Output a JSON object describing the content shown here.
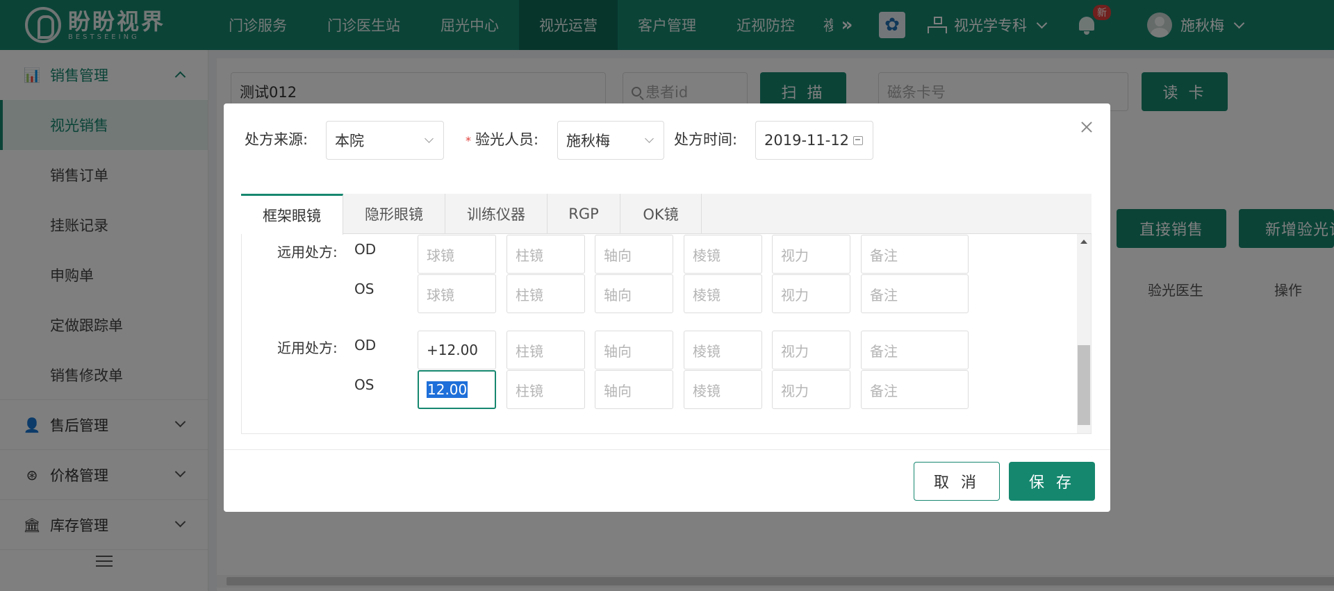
{
  "app": {
    "logo_cn": "盼盼视界",
    "logo_en": "BESTSEEING"
  },
  "topnav": {
    "items": [
      "门诊服务",
      "门诊医生站",
      "屈光中心",
      "视光运营",
      "客户管理",
      "近视防控",
      "複"
    ],
    "active_index": 3,
    "more_icon": "double-chevron-right-icon",
    "department": "视光学专科",
    "notification_badge": "新",
    "user_name": "施秋梅"
  },
  "sidebar": {
    "groups": [
      {
        "label": "销售管理",
        "icon": "chart-icon",
        "open": true,
        "items": [
          "视光销售",
          "销售订单",
          "挂账记录",
          "申购单",
          "定做跟踪单",
          "销售修改单"
        ],
        "active_index": 0
      },
      {
        "label": "售后管理",
        "icon": "user-service-icon",
        "open": false
      },
      {
        "label": "价格管理",
        "icon": "price-icon",
        "open": false
      },
      {
        "label": "库存管理",
        "icon": "warehouse-icon",
        "open": false
      }
    ]
  },
  "main": {
    "patient_name_value": "测试012",
    "patient_id_placeholder": "患者id",
    "scan_button": "扫 描",
    "card_placeholder": "磁条卡号",
    "read_card_button": "读 卡",
    "direct_sale_button": "直接销售",
    "add_optometry_button": "新增验光记",
    "table_headers": [
      "验光医生",
      "操作"
    ]
  },
  "modal": {
    "source_label": "处方来源:",
    "source_value": "本院",
    "optometrist_label": "验光人员:",
    "optometrist_value": "施秋梅",
    "time_label": "处方时间:",
    "time_value": "2019-11-12",
    "tabs": [
      "框架眼镜",
      "隐形眼镜",
      "训练仪器",
      "RGP",
      "OK镜"
    ],
    "active_tab": 0,
    "far_label": "远用处方:",
    "near_label": "近用处方:",
    "eyes": [
      "OD",
      "OS"
    ],
    "placeholders": [
      "球镜",
      "柱镜",
      "轴向",
      "棱镜",
      "视力",
      "备注"
    ],
    "near_od_sphere": "+12.00",
    "near_os_sphere": "12.00",
    "cancel_button": "取 消",
    "save_button": "保 存"
  }
}
